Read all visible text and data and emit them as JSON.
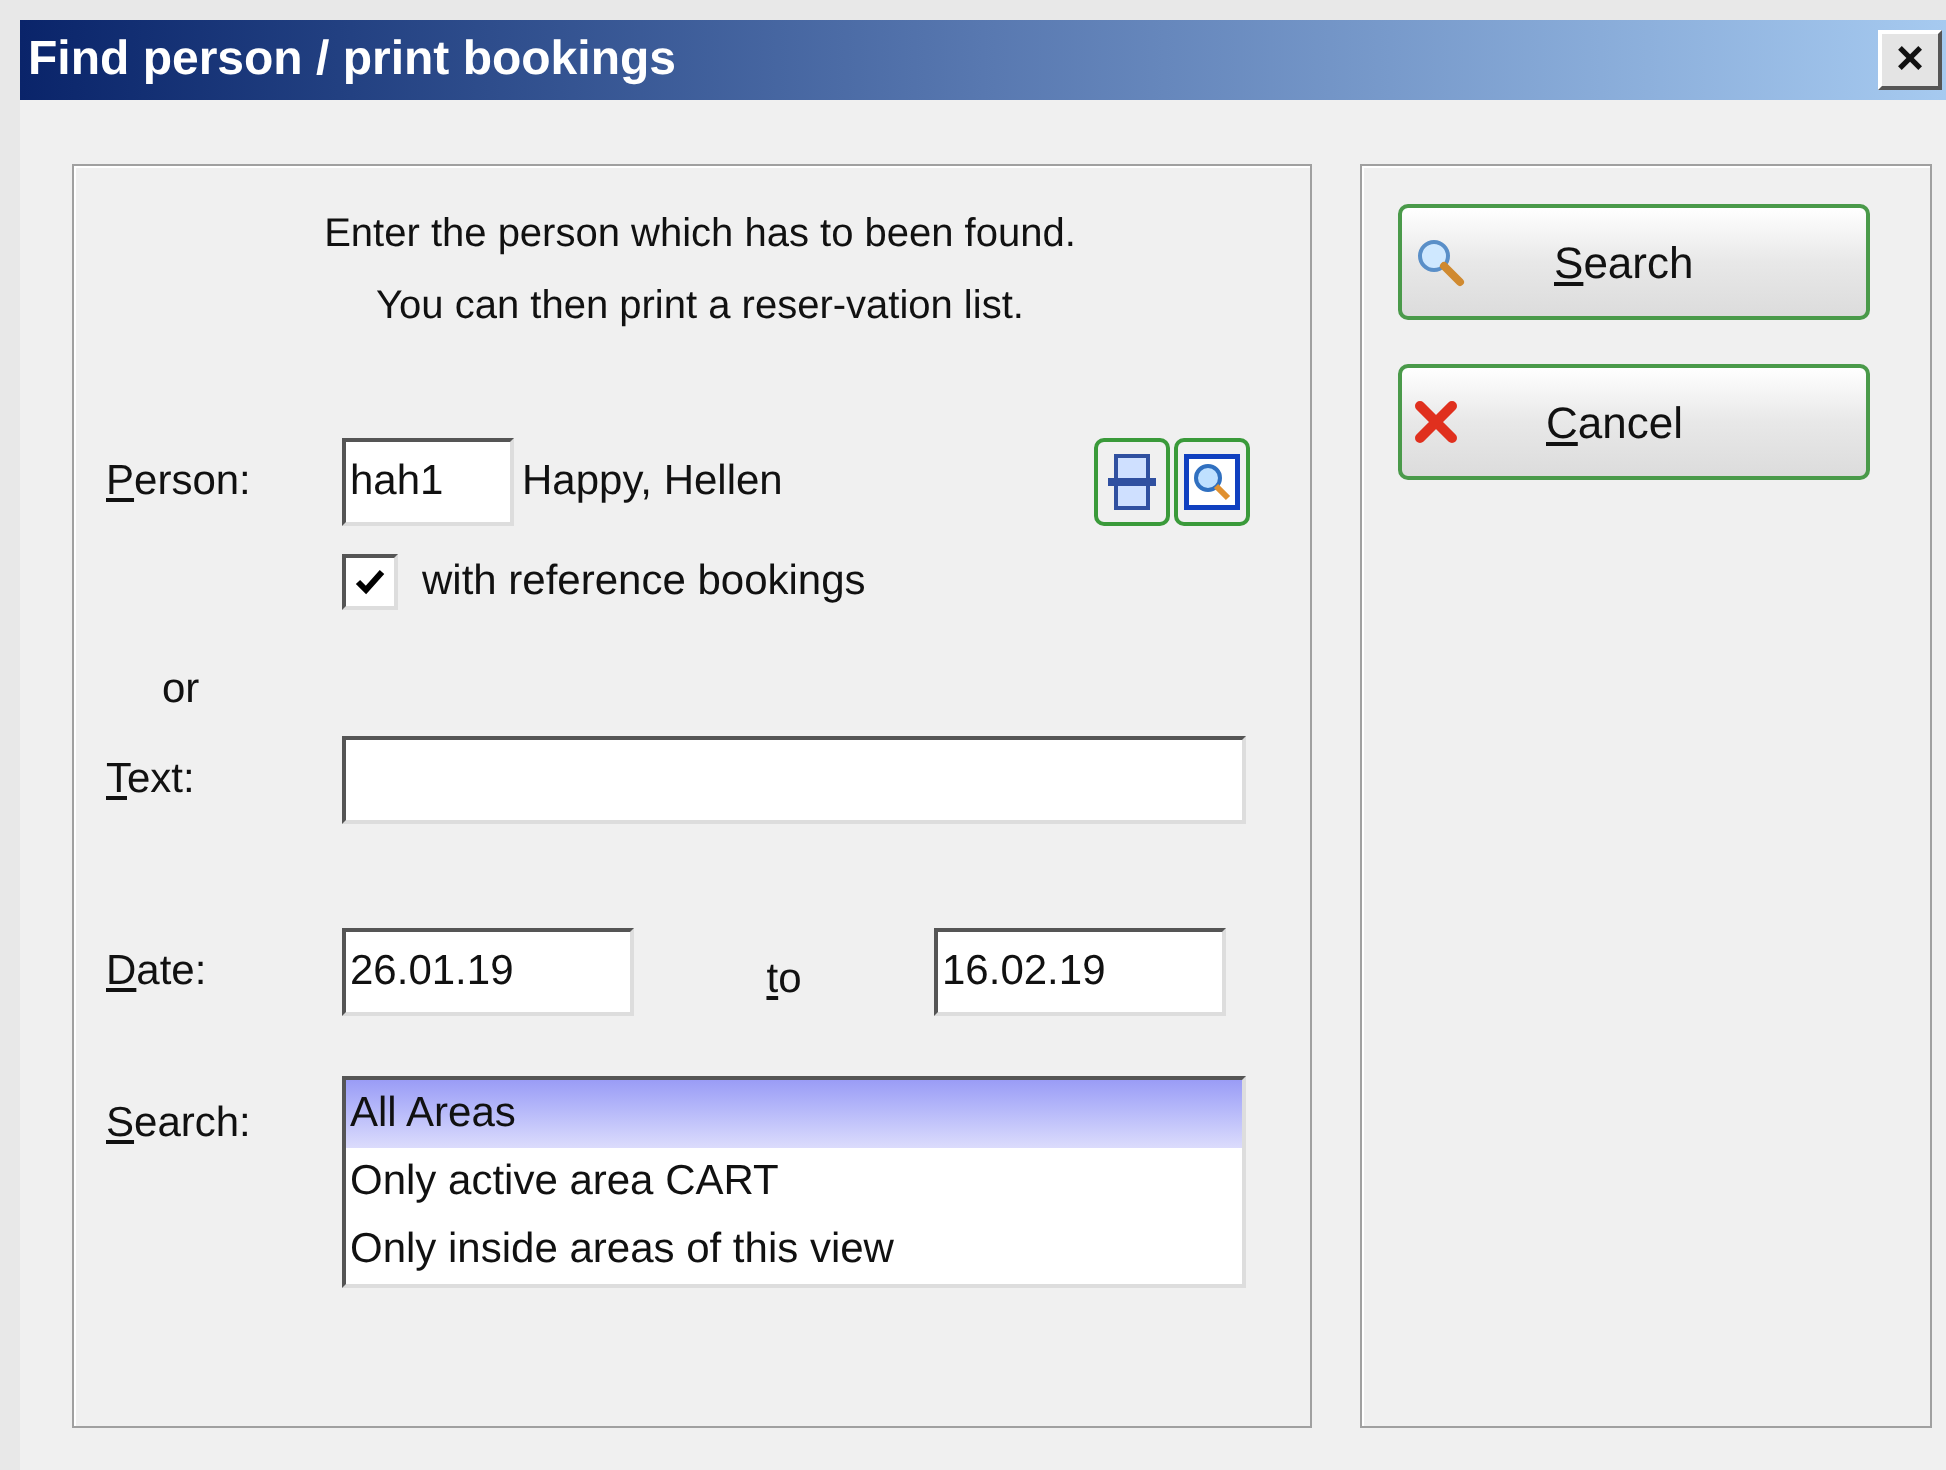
{
  "window": {
    "title": "Find person / print bookings",
    "close": "×"
  },
  "instructions": "Enter the person which has to been found. You can then print a reser-vation list.",
  "person": {
    "label": {
      "key": "P",
      "rest": "erson:"
    },
    "value": "hah1",
    "name": "Happy, Hellen"
  },
  "reference_bookings": {
    "label": "with reference bookings",
    "checked": true
  },
  "or": "or",
  "text": {
    "label": {
      "key": "T",
      "rest": "ext:"
    }
  },
  "date": {
    "label": {
      "key": "D",
      "rest": "ate:"
    },
    "from": "26.01.19",
    "to_label": {
      "key": "t",
      "rest": "o"
    },
    "to": "16.02.19"
  },
  "search": {
    "label": {
      "key": "S",
      "rest": "earch:"
    },
    "options": [
      {
        "label": "All Areas",
        "selected": true
      },
      {
        "label": "Only active area CART",
        "selected": false
      },
      {
        "label": "Only inside areas of this view",
        "selected": false
      }
    ]
  },
  "buttons": [
    {
      "kind": "search",
      "label": {
        "key": "S",
        "rest": "earch"
      }
    },
    {
      "kind": "cancel",
      "label": {
        "key": "C",
        "rest": "ancel"
      }
    }
  ]
}
